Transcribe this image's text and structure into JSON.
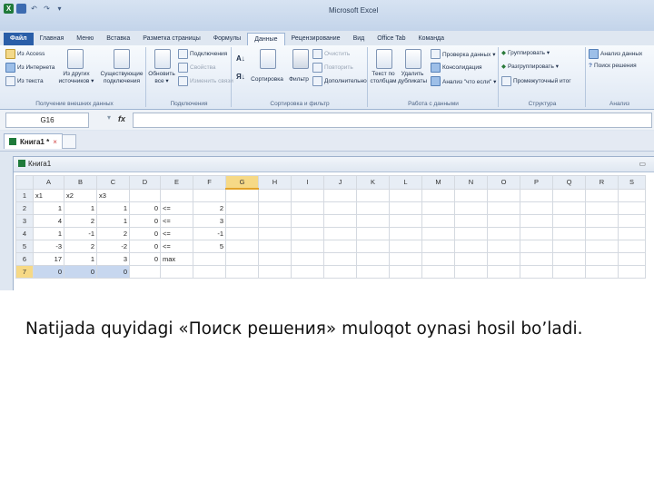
{
  "app_title": "Microsoft Excel",
  "ribbon_tabs": [
    "Файл",
    "Главная",
    "Меню",
    "Вставка",
    "Разметка страницы",
    "Формулы",
    "Данные",
    "Рецензирование",
    "Вид",
    "Office Tab",
    "Команда"
  ],
  "active_tab": "Данные",
  "ribbon": {
    "external": {
      "from_access": "Из Access",
      "from_web": "Из Интернета",
      "from_text": "Из текста",
      "from_other": "Из других\nисточников ▾",
      "existing": "Существующие\nподключения",
      "label": "Получение внешних данных"
    },
    "connections": {
      "refresh": "Обновить\nвсе ▾",
      "connections": "Подключения",
      "properties": "Свойства",
      "edit_links": "Изменить связи",
      "label": "Подключения"
    },
    "sort": {
      "sort": "Сортировка",
      "filter": "Фильтр",
      "clear": "Очистить",
      "reapply": "Повторить",
      "advanced": "Дополнительно",
      "label": "Сортировка и фильтр"
    },
    "datatools": {
      "text_to_cols": "Текст по\nстолбцам",
      "remove_dup": "Удалить\nдубликаты",
      "validation": "Проверка данных ▾",
      "consolidate": "Консолидация",
      "whatif": "Анализ \"что если\" ▾",
      "label": "Работа с данными"
    },
    "outline": {
      "group": "Группировать ▾",
      "ungroup": "Разгруппировать ▾",
      "subtotal": "Промежуточный итог",
      "label": "Структура"
    },
    "analysis": {
      "data_analysis": "Анализ данных",
      "solver": "Поиск решения",
      "label": "Анализ"
    }
  },
  "name_box": "G16",
  "fx_symbol": "fx",
  "doc_tab": "Книга1 *",
  "doc_tab_close": "×",
  "workbook_title": "Книга1",
  "workbook_min": "▭",
  "columns": [
    "A",
    "B",
    "C",
    "D",
    "E",
    "F",
    "G",
    "H",
    "I",
    "J",
    "K",
    "L",
    "M",
    "N",
    "O",
    "P",
    "Q",
    "R",
    "S"
  ],
  "selected_column": "G",
  "rows": [
    {
      "n": "1",
      "cells": [
        "x1",
        "x2",
        "x3",
        "",
        "",
        "",
        "",
        "",
        "",
        "",
        "",
        "",
        "",
        "",
        "",
        "",
        "",
        "",
        ""
      ]
    },
    {
      "n": "2",
      "cells": [
        "1",
        "1",
        "1",
        "0",
        "<=",
        "2",
        "",
        "",
        "",
        "",
        "",
        "",
        "",
        "",
        "",
        "",
        "",
        "",
        ""
      ]
    },
    {
      "n": "3",
      "cells": [
        "4",
        "2",
        "1",
        "0",
        "<=",
        "3",
        "",
        "",
        "",
        "",
        "",
        "",
        "",
        "",
        "",
        "",
        "",
        "",
        ""
      ]
    },
    {
      "n": "4",
      "cells": [
        "1",
        "-1",
        "2",
        "0",
        "<=",
        "-1",
        "",
        "",
        "",
        "",
        "",
        "",
        "",
        "",
        "",
        "",
        "",
        "",
        ""
      ]
    },
    {
      "n": "5",
      "cells": [
        "-3",
        "2",
        "-2",
        "0",
        "<=",
        "5",
        "",
        "",
        "",
        "",
        "",
        "",
        "",
        "",
        "",
        "",
        "",
        "",
        ""
      ]
    },
    {
      "n": "6",
      "cells": [
        "17",
        "1",
        "3",
        "0",
        "max",
        "",
        "",
        "",
        "",
        "",
        "",
        "",
        "",
        "",
        "",
        "",
        "",
        "",
        ""
      ]
    },
    {
      "n": "7",
      "cells": [
        "0",
        "0",
        "0",
        "",
        "",
        "",
        "",
        "",
        "",
        "",
        "",
        "",
        "",
        "",
        "",
        "",
        "",
        "",
        ""
      ]
    }
  ],
  "caption": "Natijada quyidagi «Поиск решения» muloqot  oynasi hosil bo’ladi."
}
